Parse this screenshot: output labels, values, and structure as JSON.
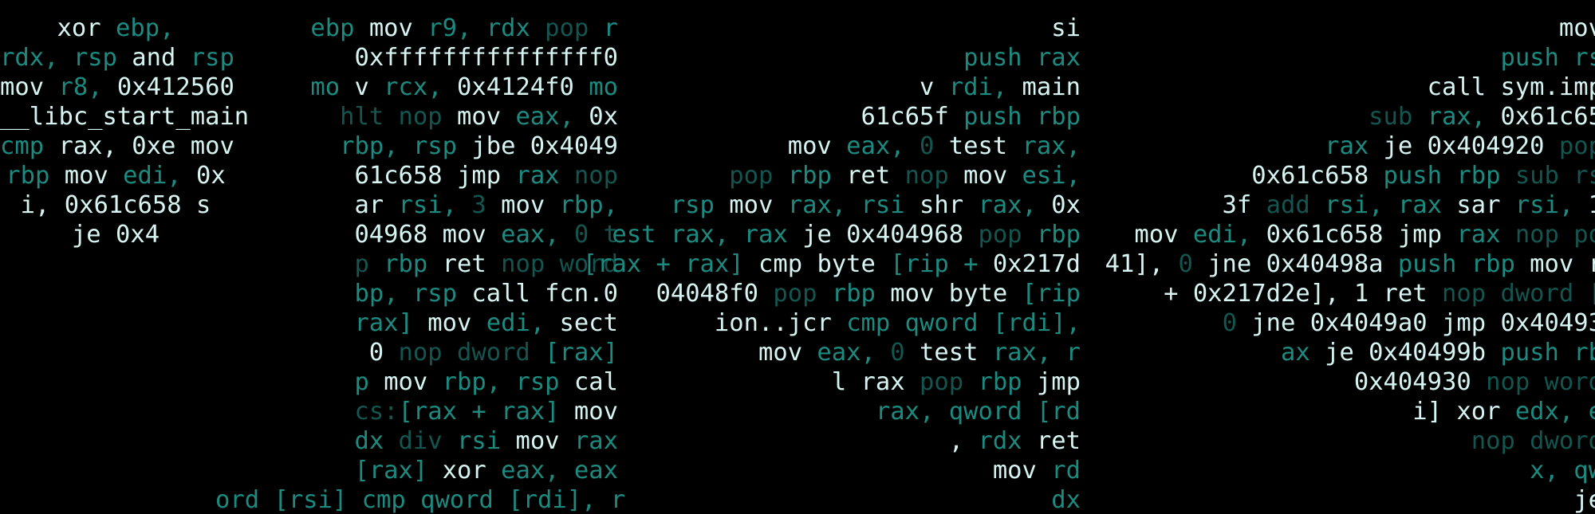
{
  "palette": {
    "background": "#000000",
    "white": "#d6f5f2",
    "bright": "#2dc5b6",
    "mid": "#1d8a80",
    "dim": "#14554f"
  },
  "columns": [
    {
      "name": "left",
      "lines": [
        [
          [
            "w",
            "xor "
          ],
          [
            "m",
            "ebp,"
          ]
        ],
        [
          [
            "m",
            "rdx, rsp "
          ],
          [
            "w",
            "and "
          ],
          [
            "m",
            "rsp"
          ]
        ],
        [
          [
            "w",
            "mov "
          ],
          [
            "m",
            "r8, "
          ],
          [
            "w",
            "0x412560"
          ]
        ],
        [
          [
            "w",
            "__libc_start_main"
          ]
        ],
        [
          [
            "m",
            "cmp "
          ],
          [
            "w",
            "rax, "
          ],
          [
            "w",
            "0xe "
          ],
          [
            "w",
            "mov"
          ]
        ],
        [
          [
            "m",
            "rbp "
          ],
          [
            "w",
            "mov "
          ],
          [
            "m",
            "edi, "
          ],
          [
            "w",
            "0x"
          ]
        ],
        [
          [
            "w",
            "i, 0x61c658 s"
          ]
        ],
        [
          [
            "w",
            "je 0x4"
          ]
        ]
      ]
    },
    {
      "name": "left-center",
      "lines": [
        [
          [
            "m",
            "ebp "
          ],
          [
            "w",
            "mov "
          ],
          [
            "m",
            "r9, rdx "
          ],
          [
            "d",
            "pop "
          ],
          [
            "m",
            "r"
          ]
        ],
        [
          [
            "w",
            "0xfffffffffffffff0"
          ]
        ],
        [
          [
            "m",
            "mo "
          ],
          [
            "w",
            "v "
          ],
          [
            "m",
            "rcx, "
          ],
          [
            "w",
            "0x4124f0 "
          ],
          [
            "m",
            "mo"
          ]
        ],
        [
          [
            "d",
            "hlt nop "
          ],
          [
            "w",
            "mov "
          ],
          [
            "m",
            "eax, "
          ],
          [
            "w",
            "0x"
          ]
        ],
        [
          [
            "m",
            "rbp, rsp "
          ],
          [
            "w",
            "jbe 0x4049"
          ]
        ],
        [
          [
            "w",
            "61c658 jmp "
          ],
          [
            "m",
            "rax "
          ],
          [
            "d",
            "nop"
          ]
        ],
        [
          [
            "w",
            "ar "
          ],
          [
            "m",
            "rsi, "
          ],
          [
            "d",
            "3 "
          ],
          [
            "w",
            "mov "
          ],
          [
            "m",
            "rbp,"
          ]
        ],
        [
          [
            "w",
            "04968 "
          ],
          [
            "w",
            "mov "
          ],
          [
            "m",
            "eax, "
          ],
          [
            "d",
            "0 t"
          ]
        ],
        [
          [
            "d",
            "p "
          ],
          [
            "m",
            "rbp "
          ],
          [
            "w",
            "ret "
          ],
          [
            "d",
            "nop word"
          ]
        ],
        [
          [
            "m",
            "bp, rsp "
          ],
          [
            "w",
            "call fcn.0"
          ]
        ],
        [
          [
            "m",
            "rax] "
          ],
          [
            "w",
            "mov "
          ],
          [
            "m",
            "edi, "
          ],
          [
            "w",
            "sect"
          ]
        ],
        [
          [
            "w",
            "0 "
          ],
          [
            "d",
            "nop dword "
          ],
          [
            "m",
            "[rax]"
          ]
        ],
        [
          [
            "m",
            "p "
          ],
          [
            "w",
            "mov "
          ],
          [
            "m",
            "rbp, rsp "
          ],
          [
            "w",
            "cal"
          ]
        ],
        [
          [
            "d",
            "cs:"
          ],
          [
            "m",
            "[rax + rax] "
          ],
          [
            "w",
            "mov"
          ]
        ],
        [
          [
            "m",
            "dx "
          ],
          [
            "d",
            "div "
          ],
          [
            "m",
            "rsi "
          ],
          [
            "w",
            "mov "
          ],
          [
            "m",
            "rax"
          ]
        ],
        [
          [
            "m",
            "[rax] "
          ],
          [
            "w",
            "xor "
          ],
          [
            "m",
            "eax, eax"
          ]
        ],
        [
          [
            "m",
            "ord [rsi] cmp qword [rdi], r"
          ]
        ]
      ]
    },
    {
      "name": "right-center",
      "lines": [
        [
          [
            "w",
            "si"
          ]
        ],
        [
          [
            "m",
            "push rax"
          ]
        ],
        [
          [
            "w",
            "v "
          ],
          [
            "m",
            "rdi, "
          ],
          [
            "w",
            "main"
          ]
        ],
        [
          [
            "w",
            "61c65f "
          ],
          [
            "m",
            "push rbp"
          ]
        ],
        [
          [
            "w",
            "mov "
          ],
          [
            "m",
            "eax, "
          ],
          [
            "d",
            "0 "
          ],
          [
            "w",
            "test "
          ],
          [
            "m",
            "rax,"
          ]
        ],
        [
          [
            "d",
            "pop "
          ],
          [
            "m",
            "rbp "
          ],
          [
            "w",
            "ret "
          ],
          [
            "d",
            "nop "
          ],
          [
            "w",
            "mov "
          ],
          [
            "m",
            "esi,"
          ]
        ],
        [
          [
            "m",
            "rsp "
          ],
          [
            "w",
            "mov "
          ],
          [
            "m",
            "rax, rsi "
          ],
          [
            "w",
            "shr "
          ],
          [
            "m",
            "rax, "
          ],
          [
            "w",
            "0x"
          ]
        ],
        [
          [
            "m",
            "est rax, rax "
          ],
          [
            "w",
            "je 0x404968 "
          ],
          [
            "d",
            "pop "
          ],
          [
            "m",
            "rbp"
          ]
        ],
        [
          [
            "m",
            "[rax + rax] "
          ],
          [
            "w",
            "cmp byte "
          ],
          [
            "m",
            "[rip + "
          ],
          [
            "w",
            "0x217d"
          ]
        ],
        [
          [
            "w",
            "04048f0 "
          ],
          [
            "d",
            "pop "
          ],
          [
            "m",
            "rbp "
          ],
          [
            "w",
            "mov byte "
          ],
          [
            "m",
            "[rip"
          ]
        ],
        [
          [
            "w",
            "ion..jcr "
          ],
          [
            "m",
            "cmp qword [rdi],"
          ]
        ],
        [
          [
            "w",
            "mov "
          ],
          [
            "m",
            "eax, "
          ],
          [
            "d",
            "0 "
          ],
          [
            "w",
            "test "
          ],
          [
            "m",
            "rax, r"
          ]
        ],
        [
          [
            "w",
            "l rax "
          ],
          [
            "d",
            "pop "
          ],
          [
            "m",
            "rbp "
          ],
          [
            "w",
            "jmp"
          ]
        ],
        [
          [
            "m",
            "rax, qword [rd"
          ]
        ],
        [
          [
            "w",
            ", "
          ],
          [
            "m",
            "rdx "
          ],
          [
            "w",
            "ret"
          ]
        ],
        [
          [
            "w",
            "mov "
          ],
          [
            "m",
            "rd"
          ]
        ],
        [
          [
            "m",
            "dx"
          ]
        ]
      ]
    },
    {
      "name": "right",
      "lines": [
        [
          [
            "w",
            "mov"
          ]
        ],
        [
          [
            "m",
            "push rs"
          ]
        ],
        [
          [
            "w",
            "call sym.imp"
          ]
        ],
        [
          [
            "d",
            "sub "
          ],
          [
            "m",
            "rax, "
          ],
          [
            "w",
            "0x61c65"
          ]
        ],
        [
          [
            "m",
            "rax "
          ],
          [
            "w",
            "je 0x404920 "
          ],
          [
            "d",
            "pop"
          ]
        ],
        [
          [
            "w",
            "0x61c658 "
          ],
          [
            "m",
            "push rbp "
          ],
          [
            "d",
            "sub rs"
          ]
        ],
        [
          [
            "w",
            "3f "
          ],
          [
            "d",
            "add "
          ],
          [
            "m",
            "rsi, rax "
          ],
          [
            "w",
            "sar "
          ],
          [
            "m",
            "rsi, "
          ],
          [
            "w",
            "1"
          ]
        ],
        [
          [
            "w",
            "mov "
          ],
          [
            "m",
            "edi, "
          ],
          [
            "w",
            "0x61c658 jmp "
          ],
          [
            "m",
            "rax "
          ],
          [
            "d",
            "nop po"
          ]
        ],
        [
          [
            "w",
            "41], "
          ],
          [
            "d",
            "0 "
          ],
          [
            "w",
            "jne 0x40498a "
          ],
          [
            "m",
            "push rbp "
          ],
          [
            "w",
            "mov r"
          ]
        ],
        [
          [
            "w",
            "+ 0x217d2e], "
          ],
          [
            "w",
            "1 ret "
          ],
          [
            "d",
            "nop dword ["
          ]
        ],
        [
          [
            "d",
            "0 "
          ],
          [
            "w",
            "jne 0x4049a0 jmp 0x40493"
          ]
        ],
        [
          [
            "m",
            "ax "
          ],
          [
            "w",
            "je 0x40499b "
          ],
          [
            "m",
            "push rb"
          ]
        ],
        [
          [
            "w",
            "0x404930 "
          ],
          [
            "d",
            "nop word"
          ]
        ],
        [
          [
            "w",
            "i] xor "
          ],
          [
            "m",
            "edx, e"
          ]
        ],
        [
          [
            "d",
            "nop dword"
          ]
        ],
        [
          [
            "m",
            "x, qw"
          ]
        ],
        [
          [
            "w",
            "je"
          ]
        ]
      ]
    }
  ]
}
